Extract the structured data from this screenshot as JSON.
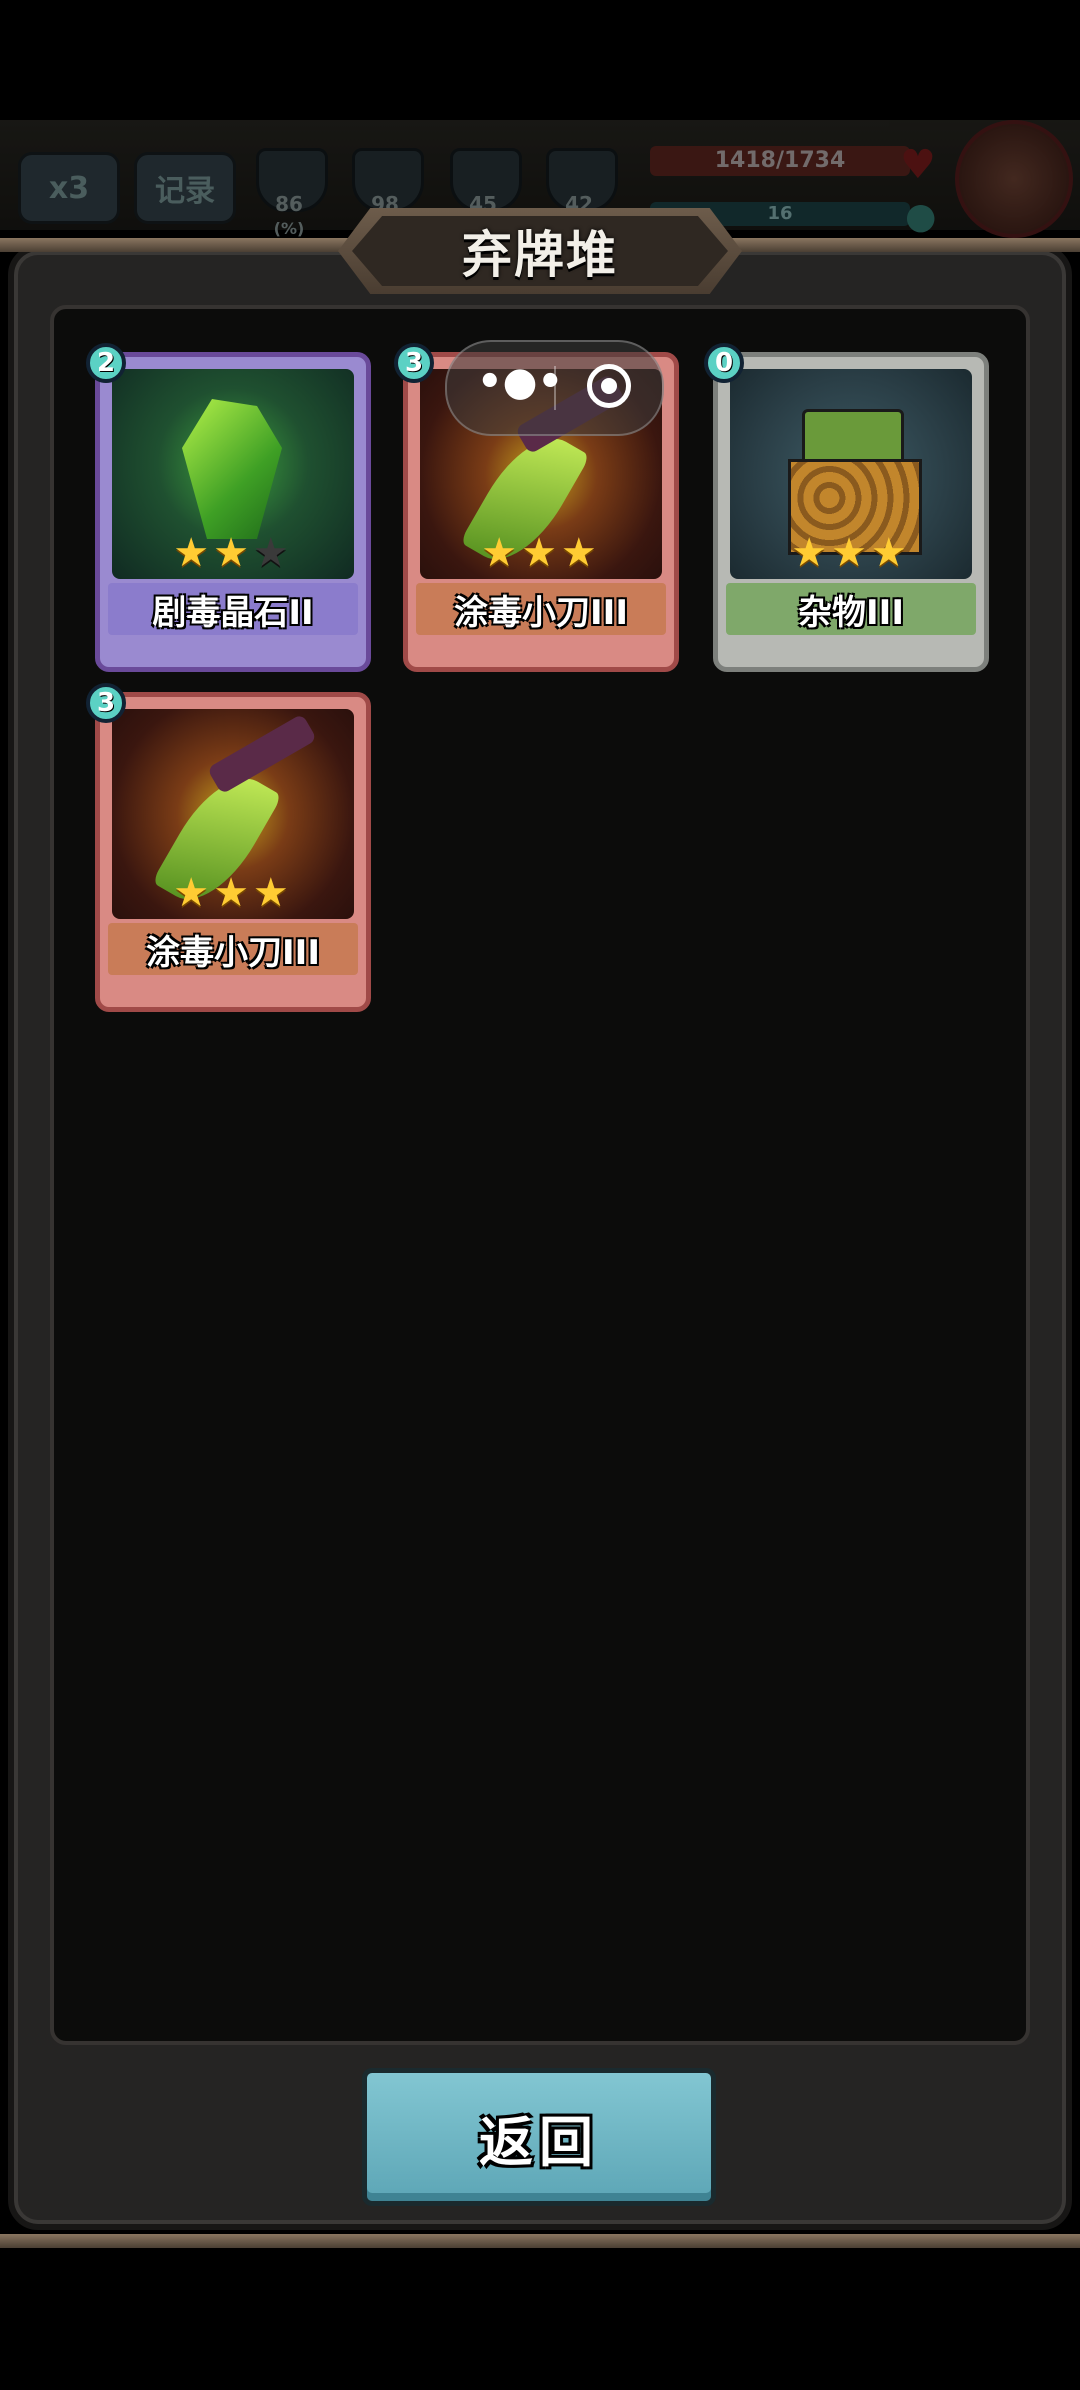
{
  "hud": {
    "multiplier": "x3",
    "log_label": "记录",
    "stats": [
      "86",
      "98",
      "45",
      "42"
    ],
    "stat_unit": "(%)",
    "hp": "1418/1734",
    "mana": "16"
  },
  "dialog": {
    "title": "弃牌堆",
    "return_label": "返回"
  },
  "cards": [
    {
      "name": "剧毒晶石II",
      "cost": "2",
      "stars_filled": 2,
      "stars_total": 3
    },
    {
      "name": "涂毒小刀III",
      "cost": "3",
      "stars_filled": 3,
      "stars_total": 3
    },
    {
      "name": "杂物III",
      "cost": "0",
      "stars_filled": 3,
      "stars_total": 3
    },
    {
      "name": "涂毒小刀III",
      "cost": "3",
      "stars_filled": 3,
      "stars_total": 3
    }
  ],
  "colors": {
    "panel": "#252423",
    "inner": "#0c0c0b",
    "button": "#6fb7c5",
    "star": "#ffcc33",
    "cost_badge": "#5bd1c4"
  },
  "icons": {
    "heart": "heart-icon",
    "drop": "drop-icon",
    "more": "more-icon",
    "close": "close-icon",
    "star": "star-icon"
  }
}
